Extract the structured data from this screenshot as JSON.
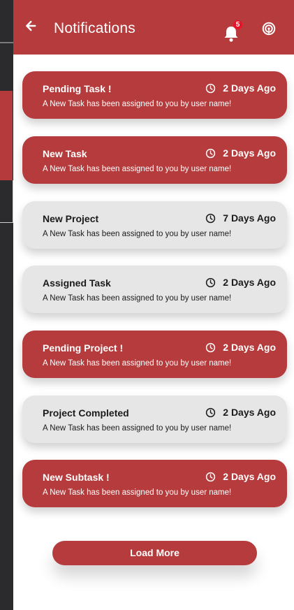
{
  "header": {
    "title": "Notifications",
    "notification_count": "5",
    "colors": {
      "accent": "#b53b3c",
      "badge": "#e8132a"
    },
    "icons": {
      "back": "arrow-left-icon",
      "notifications": "bell-icon",
      "radio": "radio-icon"
    }
  },
  "notifications": [
    {
      "title": "Pending Task !",
      "time": "2 Days Ago",
      "message": "A New Task has been assigned to you by user name!",
      "tone": "red"
    },
    {
      "title": "New Task",
      "time": "2 Days Ago",
      "message": "A New Task has been assigned to you by user name!",
      "tone": "red"
    },
    {
      "title": "New Project",
      "time": "7 Days Ago",
      "message": "A New Task has been assigned to you by user name!",
      "tone": "gray"
    },
    {
      "title": "Assigned Task",
      "time": "2 Days Ago",
      "message": "A New Task has been assigned to you by user name!",
      "tone": "gray"
    },
    {
      "title": "Pending Project !",
      "time": "2 Days Ago",
      "message": "A New Task has been assigned to you by user name!",
      "tone": "red"
    },
    {
      "title": "Project Completed",
      "time": "2 Days Ago",
      "message": "A New Task has been assigned to you by user name!",
      "tone": "gray"
    },
    {
      "title": "New Subtask !",
      "time": "2 Days Ago",
      "message": "A New Task has been assigned to you by user name!",
      "tone": "red"
    }
  ],
  "load_more_label": "Load More"
}
